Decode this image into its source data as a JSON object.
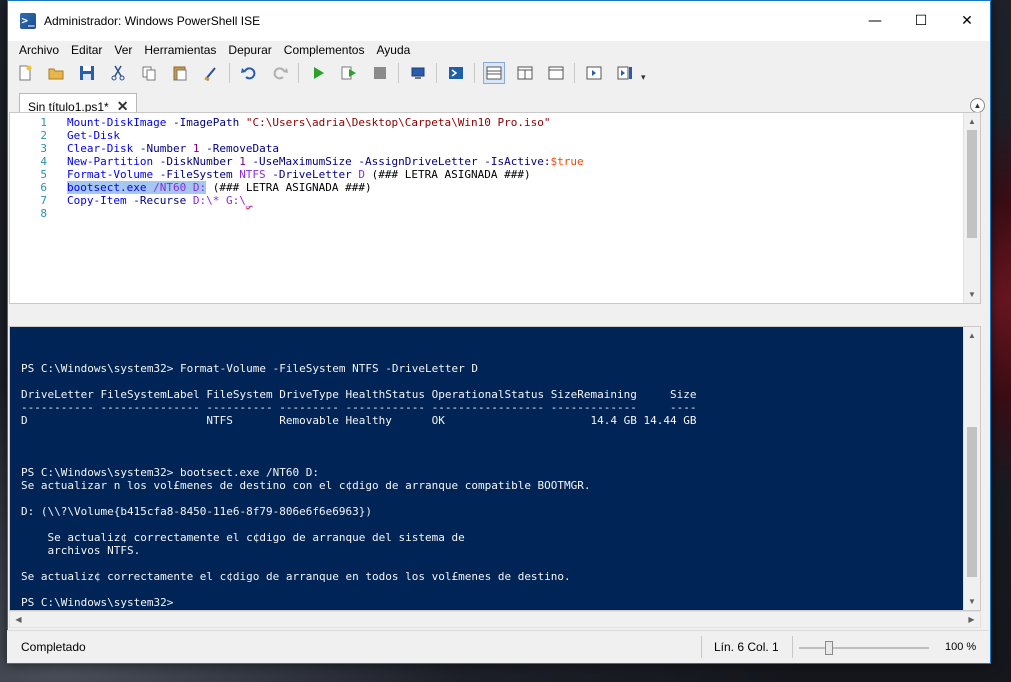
{
  "window": {
    "title": "Administrador: Windows PowerShell ISE",
    "icon_glyph": ">_",
    "controls": {
      "minimize": "—",
      "maximize": "☐",
      "close": "✕"
    }
  },
  "menu": [
    "Archivo",
    "Editar",
    "Ver",
    "Herramientas",
    "Depurar",
    "Complementos",
    "Ayuda"
  ],
  "toolbar": {
    "icons": [
      "new-file-icon",
      "open-folder-icon",
      "save-icon",
      "cut-icon",
      "copy-icon",
      "paste-icon",
      "clear-console-icon",
      "undo-icon",
      "redo-icon",
      "run-script-icon",
      "run-selection-icon",
      "stop-icon",
      "remote-powershell-icon",
      "start-powershell-icon",
      "layout-top-icon",
      "layout-right-icon",
      "layout-max-icon",
      "show-script-pane-icon",
      "show-commands-icon"
    ]
  },
  "tab": {
    "label": "Sin título1.ps1*",
    "close": "✕"
  },
  "editor": {
    "line_numbers": [
      "1",
      "2",
      "3",
      "4",
      "5",
      "6",
      "7",
      "8"
    ],
    "lines": {
      "l1": {
        "cmd": "Mount-DiskImage",
        "p1": " -ImagePath ",
        "str": "\"C:\\Users\\adria\\Desktop\\Carpeta\\Win10 Pro.iso\""
      },
      "l2": {
        "cmd": "Get-Disk"
      },
      "l3": {
        "cmd": "Clear-Disk",
        "p1": " -Number ",
        "num": "1",
        "p2": " -RemoveData"
      },
      "l4": {
        "cmd": "New-Partition",
        "p1": " -DiskNumber ",
        "num": "1",
        "p2": " -UseMaximumSize -AssignDriveLetter -IsActive:",
        "var": "$true"
      },
      "l5": {
        "cmd": "Format-Volume",
        "p1": " -FileSystem ",
        "a1": "NTFS",
        "p2": " -DriveLetter ",
        "a2": "D",
        "rest": " (### LETRA ASIGNADA ###)"
      },
      "l6": {
        "sel1": "bootsect.exe",
        "sel2": " /NT60 D:",
        "rest": " (### LETRA ASIGNADA ###)"
      },
      "l7": {
        "cmd": "Copy-Item",
        "p1": " -Recurse ",
        "a1": "D:\\*",
        "sp": " ",
        "a2": "G:\\",
        "err": "_"
      }
    }
  },
  "console": {
    "text": "PS C:\\Windows\\system32> Format-Volume -FileSystem NTFS -DriveLetter D\n\nDriveLetter FileSystemLabel FileSystem DriveType HealthStatus OperationalStatus SizeRemaining     Size\n----------- --------------- ---------- --------- ------------ ----------------- -------------     ----\nD                           NTFS       Removable Healthy      OK                      14.4 GB 14.44 GB\n\n\n\nPS C:\\Windows\\system32> bootsect.exe /NT60 D:\nSe actualizar n los vol£menes de destino con el c¢digo de arranque compatible BOOTMGR.\n\nD: (\\\\?\\Volume{b415cfa8-8450-11e6-8f79-806e6f6e6963})\n\n    Se actualiz¢ correctamente el c¢digo de arranque del sistema de\n    archivos NTFS.\n\nSe actualiz¢ correctamente el c¢digo de arranque en todos los vol£menes de destino.\n\nPS C:\\Windows\\system32>"
  },
  "status": {
    "text": "Completado",
    "position": "Lín. 6  Col. 1",
    "zoom": "100 %",
    "zoom_level_percent": 100
  },
  "colors": {
    "console_bg": "#012456",
    "cmdlet": "#0000ff",
    "parameter": "#000080",
    "string": "#8b0000",
    "variable": "#ff4500",
    "line_number": "#2b91af"
  }
}
